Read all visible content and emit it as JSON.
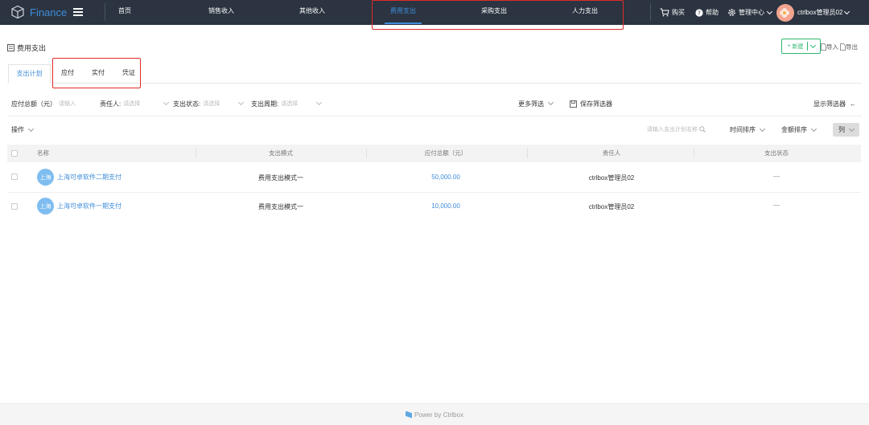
{
  "app": {
    "name": "Finance"
  },
  "nav": [
    {
      "label": "首页",
      "active": false
    },
    {
      "label": "销售收入",
      "active": false
    },
    {
      "label": "其他收入",
      "active": false
    },
    {
      "label": "费用支出",
      "active": true
    },
    {
      "label": "采购支出",
      "active": false
    },
    {
      "label": "人力支出",
      "active": false
    }
  ],
  "toolbar": {
    "buy": "购买",
    "help": "帮助",
    "admin": "管理中心",
    "user": "ctrlbox管理员02"
  },
  "page": {
    "title": "费用支出",
    "new_button": "新建",
    "import": "导入",
    "export": "导出"
  },
  "tabs": [
    {
      "label": "支出计划",
      "active": true
    },
    {
      "label": "应付",
      "active": false
    },
    {
      "label": "实付",
      "active": false
    },
    {
      "label": "凭证",
      "active": false
    }
  ],
  "filters": {
    "amount_label": "应付总额（元）",
    "amount_placeholder": "请输入",
    "owner_label": "责任人:",
    "owner_placeholder": "请选择",
    "status_label": "支出状态:",
    "status_placeholder": "请选择",
    "period_label": "支出周期:",
    "period_placeholder": "请选择",
    "more": "更多筛选",
    "save": "保存筛选器",
    "show": "显示筛选器"
  },
  "ops": {
    "operate": "操作",
    "search_placeholder": "请输入支出计划名称",
    "time_sort": "时间排序",
    "amount_sort": "金额排序",
    "columns": "列"
  },
  "table": {
    "headers": {
      "name": "名称",
      "mode": "支出模式",
      "amount": "应付总额（元）",
      "owner": "责任人",
      "status": "支出状态"
    },
    "rows": [
      {
        "avatar": "上海",
        "name": "上海可卓软件二期支付",
        "mode": "费用支出模式一",
        "amount": "50,000.00",
        "owner": "ctrlbox管理员02",
        "status": "—"
      },
      {
        "avatar": "上海",
        "name": "上海可卓软件一期支付",
        "mode": "费用支出模式一",
        "amount": "10,000.00",
        "owner": "ctrlbox管理员02",
        "status": "—"
      }
    ]
  },
  "footer": {
    "text": "Power by Ctrlbox"
  },
  "colors": {
    "topbar": "#2b3440",
    "accent": "#3f8ddb",
    "primary_green": "#2eb872",
    "highlight": "#e02b2b"
  }
}
